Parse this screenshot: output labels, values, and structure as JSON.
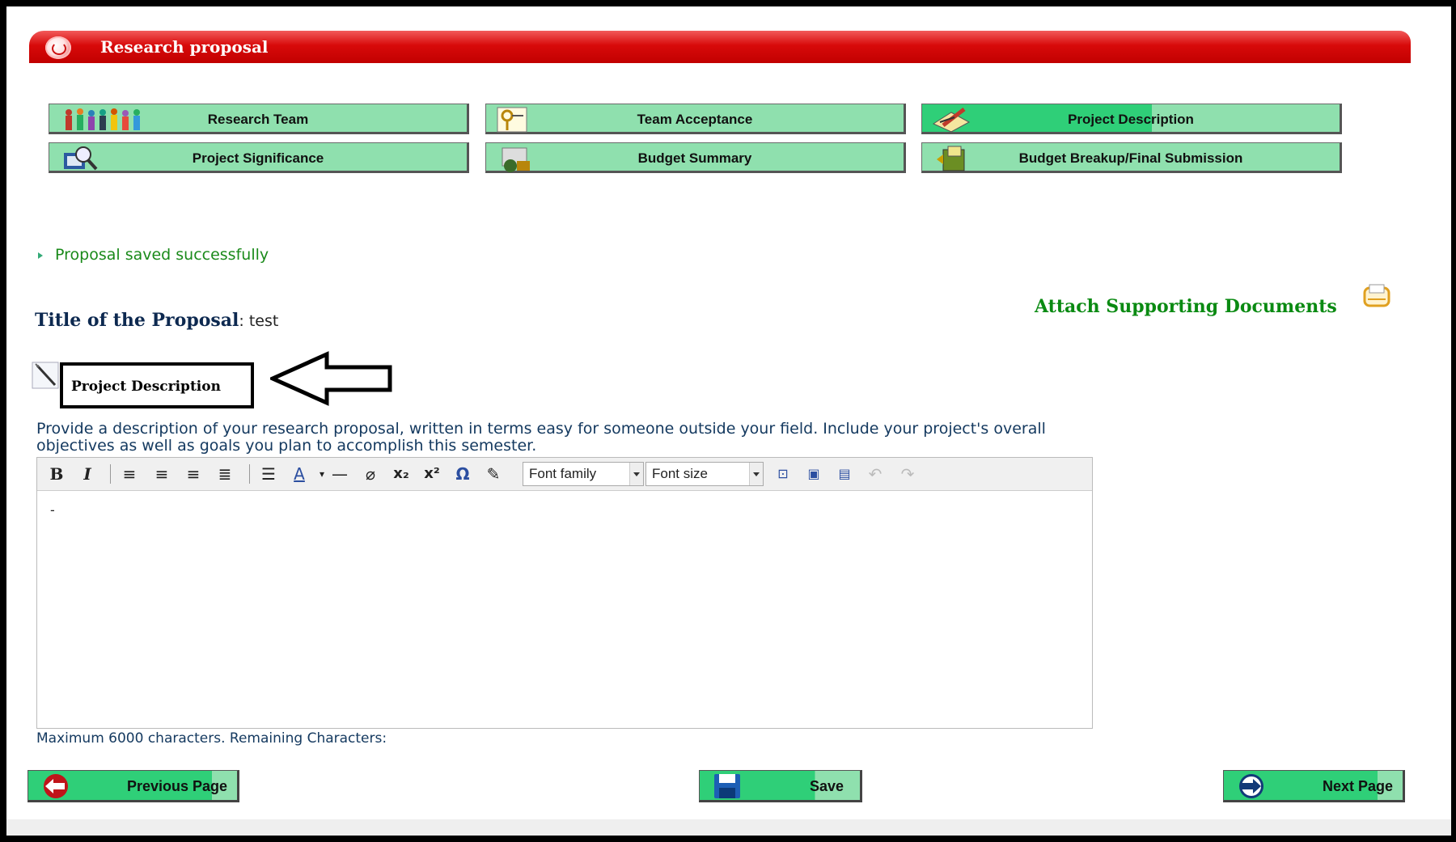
{
  "header": {
    "title": "Research proposal"
  },
  "nav": {
    "items": [
      {
        "label": "Research Team",
        "icon": "team-people-icon"
      },
      {
        "label": "Team Acceptance",
        "icon": "key-icon"
      },
      {
        "label": "Project Description",
        "icon": "pencil-paper-icon",
        "active": true
      },
      {
        "label": "Project Significance",
        "icon": "magnifier-icon"
      },
      {
        "label": "Budget Summary",
        "icon": "money-bag-icon"
      },
      {
        "label": "Budget Breakup/Final Submission",
        "icon": "folder-submit-icon"
      }
    ]
  },
  "message": {
    "text": "Proposal saved successfully"
  },
  "proposal": {
    "title_label": "Title of the Proposal",
    "title_value": ": test"
  },
  "attach": {
    "label": "Attach Supporting Documents"
  },
  "section": {
    "heading": "Project Description",
    "instructions": "Provide a description of your research proposal, written in terms easy for someone outside your field. Include your project's overall objectives as well as goals you plan to accomplish this semester."
  },
  "editor": {
    "font_family_label": "Font family",
    "font_size_label": "Font size",
    "content": "-",
    "remaining_text": "Maximum 6000 characters. Remaining Characters:"
  },
  "footer": {
    "previous_label": "Previous Page",
    "save_label": "Save",
    "next_label": "Next Page"
  },
  "colors": {
    "header_red": "#d80a0a",
    "tab_green": "#8fe0ae",
    "active_green": "#2fcf78",
    "success_green": "#1a8a1a"
  }
}
